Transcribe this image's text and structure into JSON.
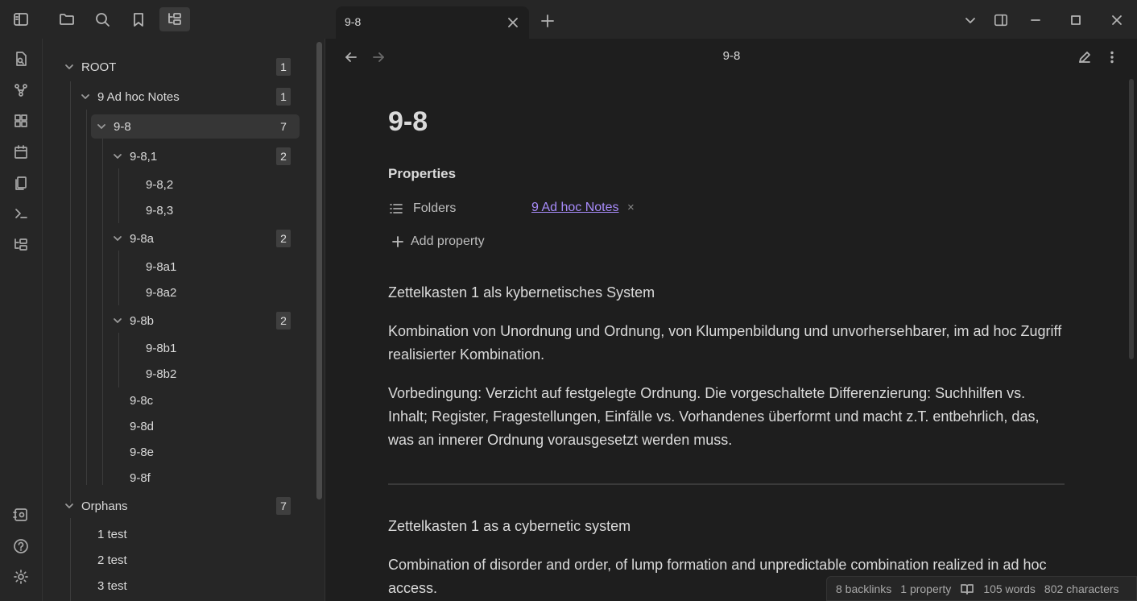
{
  "tab": {
    "title": "9-8"
  },
  "header": {
    "title": "9-8"
  },
  "tree": {
    "root": {
      "label": "ROOT",
      "count": "1"
    },
    "folder": {
      "label": "9 Ad hoc Notes",
      "count": "1"
    },
    "note": {
      "label": "9-8",
      "count": "7"
    },
    "n_9_8_1": {
      "label": "9-8,1",
      "count": "2"
    },
    "n_9_8_2": {
      "label": "9-8,2"
    },
    "n_9_8_3": {
      "label": "9-8,3"
    },
    "n_9_8a": {
      "label": "9-8a",
      "count": "2"
    },
    "n_9_8a1": {
      "label": "9-8a1"
    },
    "n_9_8a2": {
      "label": "9-8a2"
    },
    "n_9_8b": {
      "label": "9-8b",
      "count": "2"
    },
    "n_9_8b1": {
      "label": "9-8b1"
    },
    "n_9_8b2": {
      "label": "9-8b2"
    },
    "n_9_8c": {
      "label": "9-8c"
    },
    "n_9_8d": {
      "label": "9-8d"
    },
    "n_9_8e": {
      "label": "9-8e"
    },
    "n_9_8f": {
      "label": "9-8f"
    },
    "orphans": {
      "label": "Orphans",
      "count": "7"
    },
    "o1": {
      "label": "1 test"
    },
    "o2": {
      "label": "2 test"
    },
    "o3": {
      "label": "3 test"
    }
  },
  "note": {
    "title": "9-8",
    "properties_title": "Properties",
    "property_key": "Folders",
    "property_value": "9 Ad hoc Notes",
    "remove_symbol": "×",
    "add_property": "Add property",
    "p1": "Zettelkasten 1 als kybernetisches System",
    "p2": "Kombination von Unordnung und Ordnung, von Klumpenbildung und unvorhersehbarer, im ad hoc Zugriff realisierter Kombination.",
    "p3": "Vorbedingung: Verzicht auf festgelegte Ordnung. Die vorgeschaltete Differenzierung: Suchhilfen vs. Inhalt; Register, Fragestellungen, Einfälle vs. Vorhandenes überformt und macht z.T. entbehrlich, das, was an innerer Ordnung vorausgesetzt werden muss.",
    "p4": "Zettelkasten 1 as a cybernetic system",
    "p5": "Combination of disorder and order, of lump formation and unpredictable combination realized in ad hoc access."
  },
  "status": {
    "backlinks": "8 backlinks",
    "properties": "1 property",
    "words": "105 words",
    "characters": "802 characters"
  },
  "colors": {
    "accent_link": "#a78bfa",
    "background": "#1e1e1e",
    "sidebar": "#262626"
  }
}
